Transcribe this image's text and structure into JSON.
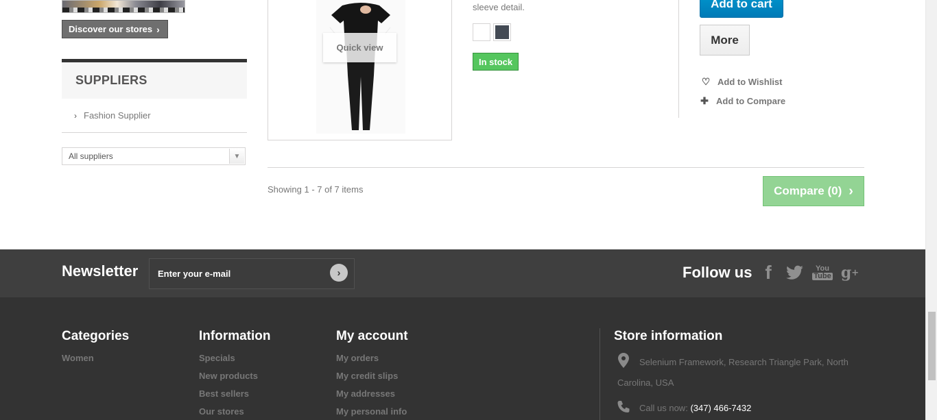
{
  "sidebar": {
    "discover_label": "Discover our stores",
    "suppliers_title": "SUPPLIERS",
    "supplier_items": [
      "Fashion Supplier"
    ],
    "supplier_select": "All suppliers"
  },
  "product": {
    "quick_view": "Quick view",
    "description": "sleeve detail.",
    "colors": [
      "#ffffff",
      "#434a54"
    ],
    "availability": "In stock",
    "add_to_cart": "Add to cart",
    "more": "More",
    "add_to_wishlist": "Add to Wishlist",
    "add_to_compare": "Add to Compare"
  },
  "listing": {
    "showing": "Showing 1 - 7 of 7 items",
    "compare_label": "Compare (0)"
  },
  "newsletter": {
    "title": "Newsletter",
    "placeholder": "Enter your e-mail",
    "follow_title": "Follow us",
    "social": [
      "facebook",
      "twitter",
      "youtube",
      "google-plus"
    ]
  },
  "footer": {
    "categories": {
      "title": "Categories",
      "links": [
        "Women"
      ]
    },
    "information": {
      "title": "Information",
      "links": [
        "Specials",
        "New products",
        "Best sellers",
        "Our stores"
      ]
    },
    "account": {
      "title": "My account",
      "links": [
        "My orders",
        "My credit slips",
        "My addresses",
        "My personal info"
      ]
    },
    "store": {
      "title": "Store information",
      "address_line1": "Selenium Framework, Research Triangle Park, North",
      "address_line2": "Carolina, USA",
      "call_label": "Call us now:",
      "phone": "(347) 466-7432"
    }
  },
  "colors": {
    "accent_blue": "#0093cf",
    "stock_green": "#55c65e",
    "compare_green": "#8ed28f",
    "footer_dark": "#333333",
    "newsletter_dark": "#3f3f3f"
  }
}
